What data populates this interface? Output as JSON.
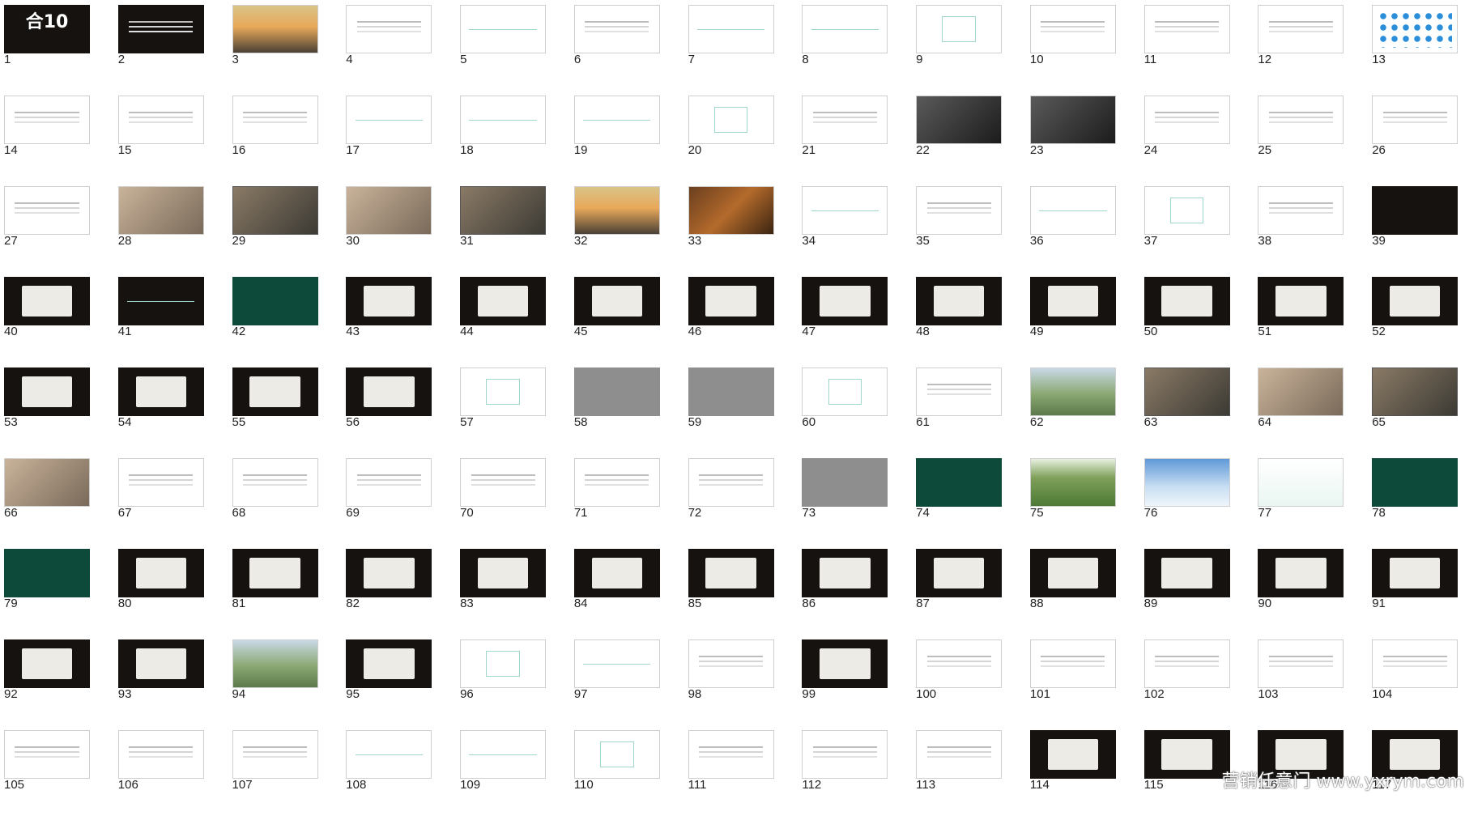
{
  "watermark": "营销任意门 www.yxrym.com",
  "slides": [
    {
      "n": "1",
      "t": "black",
      "c": "brand",
      "label": "合10"
    },
    {
      "n": "2",
      "t": "black",
      "c": "txt"
    },
    {
      "n": "3",
      "t": "sky",
      "c": "none"
    },
    {
      "n": "4",
      "t": "white",
      "c": "txt"
    },
    {
      "n": "5",
      "t": "white",
      "c": "line"
    },
    {
      "n": "6",
      "t": "white",
      "c": "txt"
    },
    {
      "n": "7",
      "t": "white",
      "c": "line"
    },
    {
      "n": "8",
      "t": "white",
      "c": "line"
    },
    {
      "n": "9",
      "t": "white",
      "c": "box"
    },
    {
      "n": "10",
      "t": "white",
      "c": "txt"
    },
    {
      "n": "11",
      "t": "white",
      "c": "txt"
    },
    {
      "n": "12",
      "t": "white",
      "c": "txt"
    },
    {
      "n": "13",
      "t": "white",
      "c": "dots"
    },
    {
      "n": "14",
      "t": "white",
      "c": "txt"
    },
    {
      "n": "15",
      "t": "white",
      "c": "txt"
    },
    {
      "n": "16",
      "t": "white",
      "c": "txt"
    },
    {
      "n": "17",
      "t": "white",
      "c": "line"
    },
    {
      "n": "18",
      "t": "white",
      "c": "line"
    },
    {
      "n": "19",
      "t": "white",
      "c": "line"
    },
    {
      "n": "20",
      "t": "white",
      "c": "box"
    },
    {
      "n": "21",
      "t": "white",
      "c": "txt"
    },
    {
      "n": "22",
      "t": "dim",
      "c": "none"
    },
    {
      "n": "23",
      "t": "dim",
      "c": "none"
    },
    {
      "n": "24",
      "t": "white",
      "c": "txt"
    },
    {
      "n": "25",
      "t": "white",
      "c": "txt"
    },
    {
      "n": "26",
      "t": "white",
      "c": "txt"
    },
    {
      "n": "27",
      "t": "white",
      "c": "txt"
    },
    {
      "n": "28",
      "t": "warm",
      "c": "none"
    },
    {
      "n": "29",
      "t": "photo",
      "c": "none"
    },
    {
      "n": "30",
      "t": "warm",
      "c": "none"
    },
    {
      "n": "31",
      "t": "photo",
      "c": "none"
    },
    {
      "n": "32",
      "t": "sky",
      "c": "none"
    },
    {
      "n": "33",
      "t": "wood",
      "c": "none"
    },
    {
      "n": "34",
      "t": "white",
      "c": "line"
    },
    {
      "n": "35",
      "t": "white",
      "c": "txt"
    },
    {
      "n": "36",
      "t": "white",
      "c": "line"
    },
    {
      "n": "37",
      "t": "white",
      "c": "box"
    },
    {
      "n": "38",
      "t": "white",
      "c": "txt"
    },
    {
      "n": "39",
      "t": "black",
      "c": "none"
    },
    {
      "n": "40",
      "t": "black",
      "c": "item"
    },
    {
      "n": "41",
      "t": "black",
      "c": "line"
    },
    {
      "n": "42",
      "t": "green",
      "c": "none"
    },
    {
      "n": "43",
      "t": "black",
      "c": "item"
    },
    {
      "n": "44",
      "t": "black",
      "c": "item"
    },
    {
      "n": "45",
      "t": "black",
      "c": "item"
    },
    {
      "n": "46",
      "t": "black",
      "c": "item"
    },
    {
      "n": "47",
      "t": "black",
      "c": "item"
    },
    {
      "n": "48",
      "t": "black",
      "c": "item"
    },
    {
      "n": "49",
      "t": "black",
      "c": "item"
    },
    {
      "n": "50",
      "t": "black",
      "c": "item"
    },
    {
      "n": "51",
      "t": "black",
      "c": "item"
    },
    {
      "n": "52",
      "t": "black",
      "c": "item"
    },
    {
      "n": "53",
      "t": "black",
      "c": "item"
    },
    {
      "n": "54",
      "t": "black",
      "c": "item"
    },
    {
      "n": "55",
      "t": "black",
      "c": "item"
    },
    {
      "n": "56",
      "t": "black",
      "c": "item"
    },
    {
      "n": "57",
      "t": "white",
      "c": "box"
    },
    {
      "n": "58",
      "t": "gray",
      "c": "none"
    },
    {
      "n": "59",
      "t": "gray",
      "c": "none"
    },
    {
      "n": "60",
      "t": "white",
      "c": "box"
    },
    {
      "n": "61",
      "t": "white",
      "c": "txt"
    },
    {
      "n": "62",
      "t": "field",
      "c": "none"
    },
    {
      "n": "63",
      "t": "photo",
      "c": "none"
    },
    {
      "n": "64",
      "t": "warm",
      "c": "none"
    },
    {
      "n": "65",
      "t": "photo",
      "c": "none"
    },
    {
      "n": "66",
      "t": "warm",
      "c": "none"
    },
    {
      "n": "67",
      "t": "white",
      "c": "txt"
    },
    {
      "n": "68",
      "t": "white",
      "c": "txt"
    },
    {
      "n": "69",
      "t": "white",
      "c": "txt"
    },
    {
      "n": "70",
      "t": "white",
      "c": "txt"
    },
    {
      "n": "71",
      "t": "white",
      "c": "txt"
    },
    {
      "n": "72",
      "t": "white",
      "c": "txt"
    },
    {
      "n": "73",
      "t": "gray",
      "c": "none"
    },
    {
      "n": "74",
      "t": "green",
      "c": "none"
    },
    {
      "n": "75",
      "t": "tree",
      "c": "none"
    },
    {
      "n": "76",
      "t": "cloud",
      "c": "none"
    },
    {
      "n": "77",
      "t": "mint",
      "c": "none"
    },
    {
      "n": "78",
      "t": "green",
      "c": "none"
    },
    {
      "n": "79",
      "t": "green",
      "c": "none"
    },
    {
      "n": "80",
      "t": "black",
      "c": "item"
    },
    {
      "n": "81",
      "t": "black",
      "c": "item"
    },
    {
      "n": "82",
      "t": "black",
      "c": "item"
    },
    {
      "n": "83",
      "t": "black",
      "c": "item"
    },
    {
      "n": "84",
      "t": "black",
      "c": "item"
    },
    {
      "n": "85",
      "t": "black",
      "c": "item"
    },
    {
      "n": "86",
      "t": "black",
      "c": "item"
    },
    {
      "n": "87",
      "t": "black",
      "c": "item"
    },
    {
      "n": "88",
      "t": "black",
      "c": "item"
    },
    {
      "n": "89",
      "t": "black",
      "c": "item"
    },
    {
      "n": "90",
      "t": "black",
      "c": "item"
    },
    {
      "n": "91",
      "t": "black",
      "c": "item"
    },
    {
      "n": "92",
      "t": "black",
      "c": "item"
    },
    {
      "n": "93",
      "t": "black",
      "c": "item"
    },
    {
      "n": "94",
      "t": "field",
      "c": "none"
    },
    {
      "n": "95",
      "t": "black",
      "c": "item"
    },
    {
      "n": "96",
      "t": "white",
      "c": "box"
    },
    {
      "n": "97",
      "t": "white",
      "c": "line"
    },
    {
      "n": "98",
      "t": "white",
      "c": "txt"
    },
    {
      "n": "99",
      "t": "black",
      "c": "item"
    },
    {
      "n": "100",
      "t": "white",
      "c": "txt"
    },
    {
      "n": "101",
      "t": "white",
      "c": "txt"
    },
    {
      "n": "102",
      "t": "white",
      "c": "txt"
    },
    {
      "n": "103",
      "t": "white",
      "c": "txt"
    },
    {
      "n": "104",
      "t": "white",
      "c": "txt"
    },
    {
      "n": "105",
      "t": "white",
      "c": "txt"
    },
    {
      "n": "106",
      "t": "white",
      "c": "txt"
    },
    {
      "n": "107",
      "t": "white",
      "c": "txt"
    },
    {
      "n": "108",
      "t": "white",
      "c": "line"
    },
    {
      "n": "109",
      "t": "white",
      "c": "line"
    },
    {
      "n": "110",
      "t": "white",
      "c": "box"
    },
    {
      "n": "111",
      "t": "white",
      "c": "txt"
    },
    {
      "n": "112",
      "t": "white",
      "c": "txt"
    },
    {
      "n": "113",
      "t": "white",
      "c": "txt"
    },
    {
      "n": "114",
      "t": "black",
      "c": "item"
    },
    {
      "n": "115",
      "t": "black",
      "c": "item"
    },
    {
      "n": "116",
      "t": "black",
      "c": "item"
    },
    {
      "n": "117",
      "t": "black",
      "c": "item"
    }
  ]
}
